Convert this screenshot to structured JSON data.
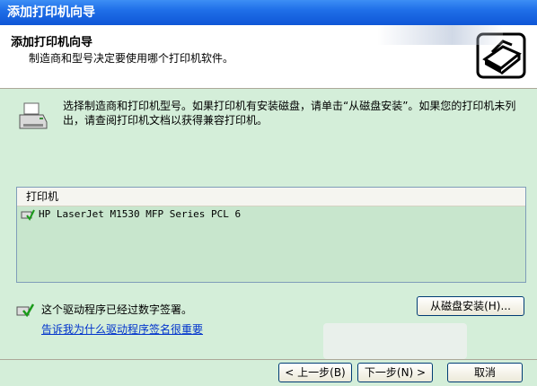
{
  "window": {
    "title": "添加打印机向导"
  },
  "header": {
    "title": "添加打印机向导",
    "subtitle": "制造商和型号决定要使用哪个打印机软件。",
    "icon": "printer-wizard-icon"
  },
  "intro": {
    "icon": "printer-icon",
    "text": "选择制造商和打印机型号。如果打印机有安装磁盘，请单击“从磁盘安装”。如果您的打印机未列出，请查阅打印机文档以获得兼容打印机。"
  },
  "printer_list": {
    "header": "打印机",
    "items": [
      {
        "label": "HP LaserJet M1530 MFP Series PCL 6",
        "icon": "signed-driver-icon"
      }
    ]
  },
  "signature": {
    "icon": "signed-driver-icon",
    "text": "这个驱动程序已经过数字签署。",
    "link": "告诉我为什么驱动程序签名很重要"
  },
  "buttons": {
    "have_disk": "从磁盘安装(H)...",
    "back": "< 上一步(B)",
    "next": "下一步(N) >",
    "cancel": "取消"
  }
}
